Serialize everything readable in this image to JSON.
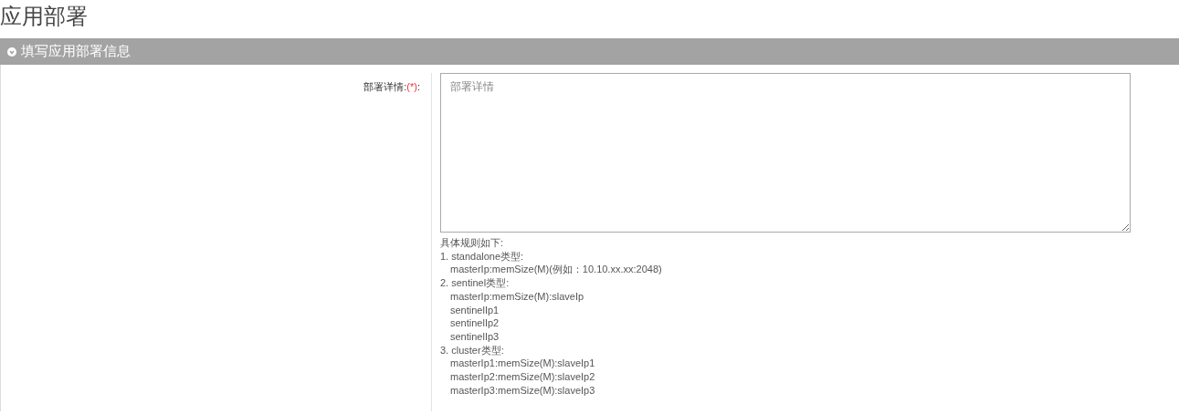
{
  "page_title": "应用部署",
  "section": {
    "title": "填写应用部署信息"
  },
  "field": {
    "label": "部署详情:",
    "required": true,
    "required_mark": "(*)",
    "label_suffix": ":",
    "placeholder": "部署详情"
  },
  "help": {
    "intro": "具体规则如下:",
    "rules": [
      {
        "text": "1. standalone类型:",
        "children": [
          {
            "text": "masterIp:memSize(M)(例如：10.10.xx.xx:2048)"
          }
        ]
      },
      {
        "text": "2. sentinel类型:",
        "children": [
          {
            "text": "masterIp:memSize(M):slaveIp"
          },
          {
            "text": "sentinelIp1"
          },
          {
            "text": "sentinelIp2"
          },
          {
            "text": "sentinelIp3"
          }
        ]
      },
      {
        "text": "3. cluster类型:",
        "children": [
          {
            "text": "masterIp1:memSize(M):slaveIp1"
          },
          {
            "text": "masterIp2:memSize(M):slaveIp2"
          },
          {
            "text": "masterIp3:memSize(M):slaveIp3"
          }
        ]
      }
    ]
  }
}
